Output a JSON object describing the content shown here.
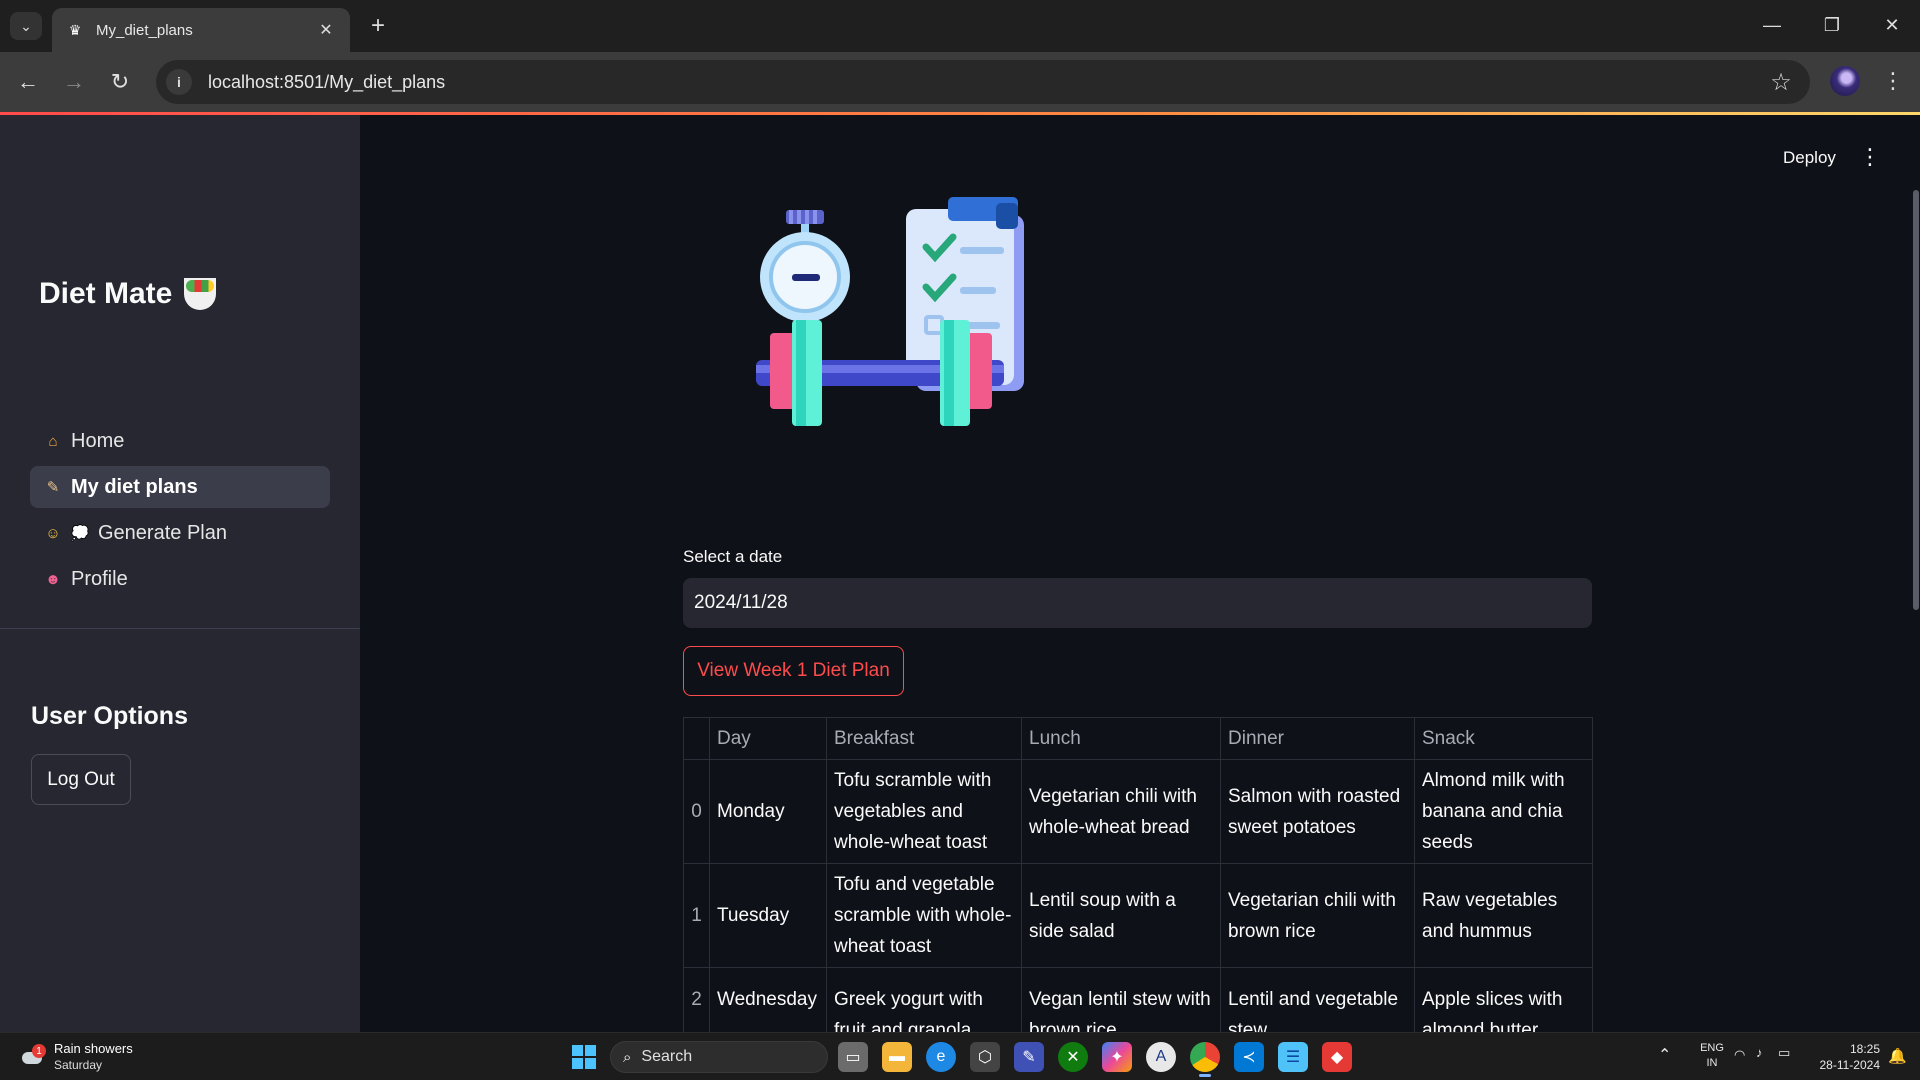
{
  "browser": {
    "tab_title": "My_diet_plans",
    "url": "localhost:8501/My_diet_plans"
  },
  "sidebar": {
    "brand": "Diet Mate",
    "nav": [
      {
        "label": "Home",
        "icon": "house-icon",
        "active": false
      },
      {
        "label": "My diet plans",
        "icon": "memo-icon",
        "active": true
      },
      {
        "label": "Generate Plan",
        "icon": "thinking-face-icon",
        "active": false
      },
      {
        "label": "Profile",
        "icon": "profile-icon",
        "active": false
      }
    ],
    "section_title": "User Options",
    "logout_label": "Log Out"
  },
  "header": {
    "deploy_label": "Deploy"
  },
  "main": {
    "date_label": "Select a date",
    "date_value": "2024/11/28",
    "view_button": "View Week 1 Diet Plan",
    "table": {
      "columns": [
        "",
        "Day",
        "Breakfast",
        "Lunch",
        "Dinner",
        "Snack"
      ],
      "rows": [
        {
          "index": "0",
          "day": "Monday",
          "breakfast": "Tofu scramble with vegetables and whole-wheat toast",
          "lunch": "Vegetarian chili with whole-wheat bread",
          "dinner": "Salmon with roasted sweet potatoes",
          "snack": "Almond milk with banana and chia seeds"
        },
        {
          "index": "1",
          "day": "Tuesday",
          "breakfast": "Tofu and vegetable scramble with whole-wheat toast",
          "lunch": "Lentil soup with a side salad",
          "dinner": "Vegetarian chili with brown rice",
          "snack": "Raw vegetables and hummus"
        },
        {
          "index": "2",
          "day": "Wednesday",
          "breakfast": "Greek yogurt with fruit and granola",
          "lunch": "Vegan lentil stew with brown rice",
          "dinner": "Lentil and vegetable stew",
          "snack": "Apple slices with almond butter"
        }
      ]
    }
  },
  "taskbar": {
    "weather_title": "Rain showers",
    "weather_sub": "Saturday",
    "weather_badge": "1",
    "search_label": "Search",
    "lang_line1": "ENG",
    "lang_line2": "IN",
    "time": "18:25",
    "date": "28-11-2024"
  },
  "colors": {
    "accent": "#ff4b4b",
    "sidebar_bg": "#262730",
    "main_bg": "#0e1117"
  }
}
